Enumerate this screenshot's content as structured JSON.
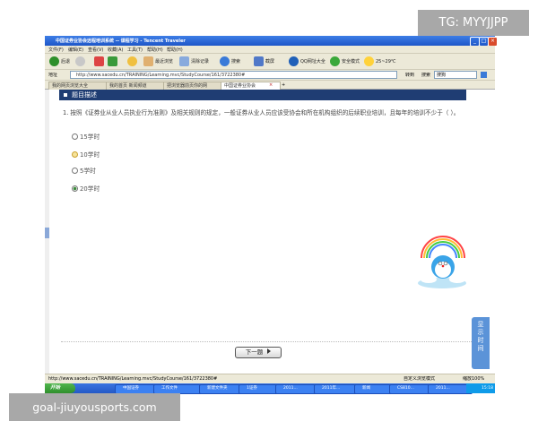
{
  "window": {
    "title": "中国证券业协会远程培训系统 -- 课程学习 - Tencent Traveler"
  },
  "menu": [
    "文件(F)",
    "编辑(E)",
    "查看(V)",
    "收藏(A)",
    "工具(T)",
    "帮助(H)",
    "帮助(H)"
  ],
  "toolbar": {
    "back": "后退",
    "items": [
      "最近浏览",
      "清除记录",
      "搜索",
      "截屏",
      "QQ网址大全",
      "安全模式"
    ],
    "weather": "25~29℃"
  },
  "address": {
    "label": "地址",
    "url": "http://www.sacedu.cn/TRAINING/Learning.mvc/StudyCourse/161/3722380#",
    "search_label": "搜索",
    "search_value": "搜狗"
  },
  "tabs": [
    "我的网页浏览大全",
    "我的首页 新闻频道",
    "把浏览器前页你的网",
    "中国证券业协会"
  ],
  "section": {
    "title": "题目描述"
  },
  "question": {
    "text": "1. 按照《证券业从业人员执业行为准则》及相关规则的规定，一般证券从业人员应该受协会和所在机构组织的后续职业培训，且每年的培训不少于（ ）。",
    "options": [
      {
        "label": "15学时",
        "selected": false
      },
      {
        "label": "10学时",
        "selected": false
      },
      {
        "label": "5学时",
        "selected": false
      },
      {
        "label": "20学时",
        "selected": true
      }
    ]
  },
  "buttons": {
    "next": "下一题"
  },
  "side_panel": {
    "label": "显示时间"
  },
  "status": {
    "url": "http://www.sacedu.cn/TRAINING/Learning.mvc/StudyCourse/161/3722380#",
    "zoom": "缩放100%",
    "mode": "自定义浏览模式"
  },
  "taskbar": {
    "start": "开始",
    "tasks": [
      "中国证券",
      "工作文件",
      "新建文件夹",
      "1证券",
      "2011...",
      "2011年...",
      "2011年...",
      "新闻",
      "CS810...",
      "2011...",
      "2011..."
    ],
    "clock": "15:18"
  },
  "watermarks": {
    "top": "TG: MYYJJPP",
    "bottom": "goal-jiuyousports.com"
  },
  "colors": {
    "titlebar": "#1e56c8",
    "section": "#1f3d73",
    "taskbar": "#2459c6",
    "panel": "#5b93d8"
  }
}
